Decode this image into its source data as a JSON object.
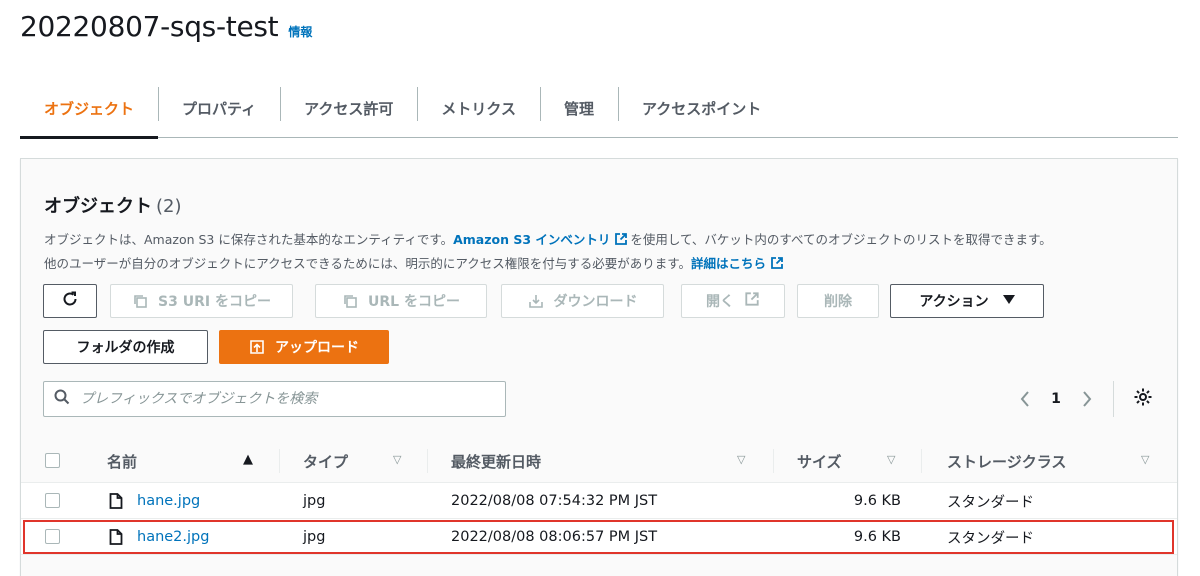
{
  "header": {
    "title": "20220807-sqs-test",
    "info_label": "情報"
  },
  "tabs": [
    {
      "label": "オブジェクト",
      "active": true
    },
    {
      "label": "プロパティ"
    },
    {
      "label": "アクセス許可"
    },
    {
      "label": "メトリクス"
    },
    {
      "label": "管理"
    },
    {
      "label": "アクセスポイント"
    }
  ],
  "panel": {
    "title": "オブジェクト",
    "count": "(2)",
    "desc_part1": "オブジェクトは、Amazon S3 に保存された基本的なエンティティです。",
    "desc_link1": "Amazon S3 インベントリ",
    "desc_part2": "を使用して、バケット内のすべてのオブジェクトのリストを取得できます。",
    "desc_part3": "他のユーザーが自分のオブジェクトにアクセスできるためには、明示的にアクセス権限を付与する必要があります。",
    "desc_link2": "詳細はこちら"
  },
  "toolbar": {
    "refresh_icon": "refresh-icon",
    "copy_s3_uri": "S3 URI をコピー",
    "copy_url": "URL をコピー",
    "download": "ダウンロード",
    "open": "開く",
    "delete": "削除",
    "actions": "アクション",
    "create_folder": "フォルダの作成",
    "upload": "アップロード"
  },
  "search": {
    "placeholder": "プレフィックスでオブジェクトを検索"
  },
  "pagination": {
    "current_page": "1"
  },
  "table": {
    "columns": [
      "名前",
      "タイプ",
      "最終更新日時",
      "サイズ",
      "ストレージクラス"
    ],
    "sorted_column": "名前",
    "rows": [
      {
        "name": "hane.jpg",
        "type": "jpg",
        "modified": "2022/08/08 07:54:32 PM JST",
        "size": "9.6 KB",
        "storage_class": "スタンダード",
        "highlighted": false
      },
      {
        "name": "hane2.jpg",
        "type": "jpg",
        "modified": "2022/08/08 08:06:57 PM JST",
        "size": "9.6 KB",
        "storage_class": "スタンダード",
        "highlighted": true
      }
    ]
  },
  "colors": {
    "accent": "#ec7211",
    "link": "#0073bb",
    "highlight_border": "#e0352b"
  }
}
